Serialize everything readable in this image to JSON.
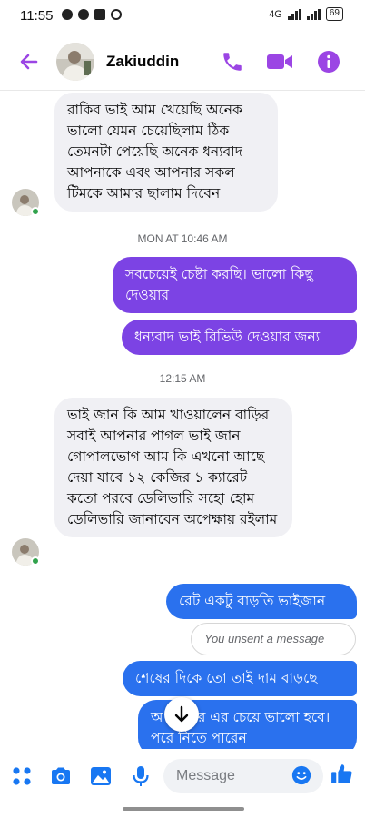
{
  "status_bar": {
    "time": "11:55",
    "network": "4G",
    "battery": "69"
  },
  "header": {
    "contact_name": "Zakiuddin"
  },
  "messages": [
    {
      "direction": "incoming",
      "text": "রাকিব ভাই আম খেয়েছি অনেক ভালো যেমন চেয়েছিলাম ঠিক তেমনটা পেয়েছি অনেক ধন্যবাদ আপনাকে এবং আপনার সকল টিমকে আমার ছালাম দিবেন"
    },
    {
      "direction": "outgoing",
      "text": "সবচেয়েই চেষ্টা করছি। ভালো কিছু দেওয়ার"
    },
    {
      "direction": "outgoing",
      "text": "ধন্যবাদ ভাই রিভিউ দেওয়ার জন্য"
    },
    {
      "direction": "incoming",
      "text": "ভাই জান কি আম খাওয়ালেন বাড়ির সবাই আপনার পাগল ভাই জান গোপালভোগ আম কি এখনো আছে দেয়া যাবে ১২ কেজির ১ ক্যারেট কতো পরবে ডেলিভারি সহো হোম ডেলিভারি জানাবেন অপেক্ষায় রইলাম"
    },
    {
      "direction": "outgoing",
      "text": "রেট একটু বাড়তি ভাইজান"
    },
    {
      "direction": "outgoing",
      "text": "শেষের দিকে তো তাই দাম বাড়ছে"
    },
    {
      "direction": "outgoing",
      "text": "অ মসাগর এর চেয়ে ভালো হবে। পরে নিতে পারেন"
    }
  ],
  "timestamps": [
    "MON AT 10:46 AM",
    "12:15 AM"
  ],
  "unsent_notice": "You unsent a message",
  "composer": {
    "placeholder": "Message"
  },
  "colors": {
    "accent": "#9b45e4",
    "bubble_purple": "#7c43e4",
    "bubble_blue": "#2a71ee",
    "incoming_bubble": "#f0f0f4",
    "composer_blue": "#1877f2"
  },
  "icons": [
    "back-arrow-icon",
    "phone-icon",
    "video-camera-icon",
    "info-icon",
    "scroll-down-arrow-icon",
    "apps-icon",
    "camera-icon",
    "gallery-icon",
    "microphone-icon",
    "emoji-icon",
    "thumbs-up-icon"
  ]
}
